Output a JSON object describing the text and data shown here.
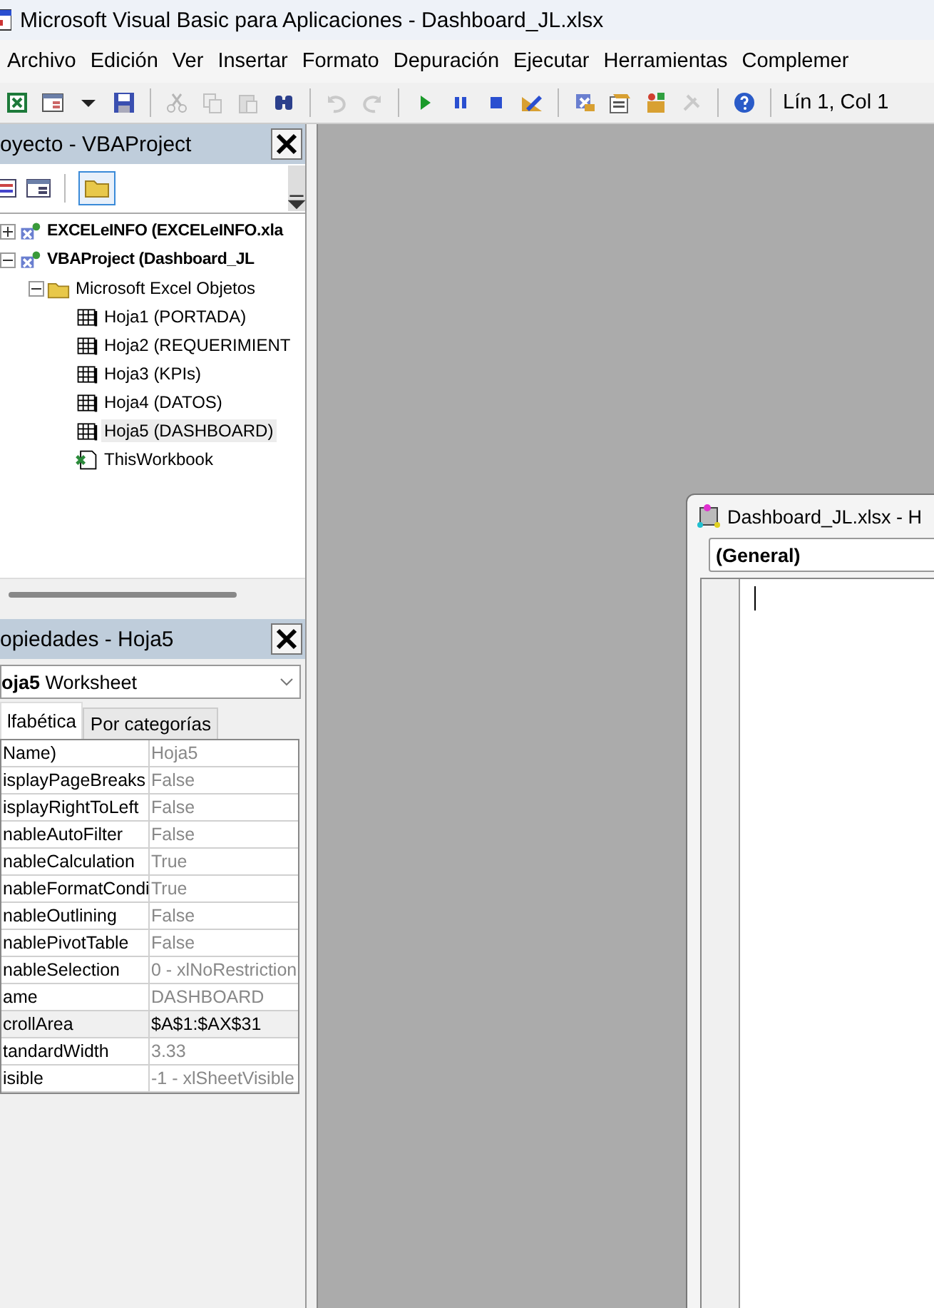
{
  "window": {
    "title": "Microsoft Visual Basic para Aplicaciones - Dashboard_JL.xlsx"
  },
  "menu": [
    "Archivo",
    "Edición",
    "Ver",
    "Insertar",
    "Formato",
    "Depuración",
    "Ejecutar",
    "Herramientas",
    "Complemer"
  ],
  "toolbar": {
    "items": [
      {
        "kind": "excel",
        "disabled": false
      },
      {
        "kind": "form",
        "disabled": false
      },
      {
        "kind": "dropdown",
        "disabled": false
      },
      {
        "kind": "save",
        "disabled": false
      },
      {
        "kind": "sep"
      },
      {
        "kind": "cut",
        "disabled": true
      },
      {
        "kind": "copy",
        "disabled": true
      },
      {
        "kind": "paste",
        "disabled": true
      },
      {
        "kind": "find",
        "disabled": false
      },
      {
        "kind": "sep"
      },
      {
        "kind": "undo",
        "disabled": true
      },
      {
        "kind": "redo",
        "disabled": true
      },
      {
        "kind": "sep"
      },
      {
        "kind": "run",
        "disabled": false
      },
      {
        "kind": "pause",
        "disabled": false
      },
      {
        "kind": "stop",
        "disabled": false
      },
      {
        "kind": "design",
        "disabled": false
      },
      {
        "kind": "sep"
      },
      {
        "kind": "explorer",
        "disabled": false
      },
      {
        "kind": "properties",
        "disabled": false
      },
      {
        "kind": "objects",
        "disabled": false
      },
      {
        "kind": "tools",
        "disabled": true
      },
      {
        "kind": "sep"
      },
      {
        "kind": "help",
        "disabled": false
      },
      {
        "kind": "sep"
      }
    ],
    "position": "Lín 1, Col 1"
  },
  "project_pane": {
    "title": "oyecto - VBAProject",
    "tree": [
      {
        "label": "EXCELeINFO (EXCELeINFO.xla",
        "kind": "project",
        "expanded": false,
        "selected": false
      },
      {
        "label": "VBAProject (Dashboard_JL",
        "kind": "project",
        "expanded": true,
        "selected": false,
        "children": [
          {
            "label": "Microsoft Excel Objetos",
            "kind": "folder",
            "expanded": true,
            "selected": false,
            "children": [
              {
                "label": "Hoja1 (PORTADA)",
                "kind": "sheet",
                "selected": false
              },
              {
                "label": "Hoja2 (REQUERIMIENT",
                "kind": "sheet",
                "selected": false
              },
              {
                "label": "Hoja3 (KPIs)",
                "kind": "sheet",
                "selected": false
              },
              {
                "label": "Hoja4 (DATOS)",
                "kind": "sheet",
                "selected": false
              },
              {
                "label": "Hoja5 (DASHBOARD)",
                "kind": "sheet",
                "selected": true
              },
              {
                "label": "ThisWorkbook",
                "kind": "workbook",
                "selected": false
              }
            ]
          }
        ]
      }
    ]
  },
  "properties_pane": {
    "title": "opiedades - Hoja5",
    "object": {
      "name": "oja5",
      "type": "Worksheet"
    },
    "tabs": [
      {
        "label": "lfabética",
        "selected": true
      },
      {
        "label": "Por categorías",
        "selected": false
      }
    ],
    "rows": [
      {
        "name": "Name)",
        "value": "Hoja5",
        "selected": false
      },
      {
        "name": "isplayPageBreaks",
        "value": "False",
        "selected": false
      },
      {
        "name": "isplayRightToLeft",
        "value": "False",
        "selected": false
      },
      {
        "name": "nableAutoFilter",
        "value": "False",
        "selected": false
      },
      {
        "name": "nableCalculation",
        "value": "True",
        "selected": false
      },
      {
        "name": "nableFormatCondi",
        "value": "True",
        "selected": false
      },
      {
        "name": "nableOutlining",
        "value": "False",
        "selected": false
      },
      {
        "name": "nablePivotTable",
        "value": "False",
        "selected": false
      },
      {
        "name": "nableSelection",
        "value": "0 - xlNoRestriction",
        "selected": false
      },
      {
        "name": "ame",
        "value": "DASHBOARD",
        "selected": false
      },
      {
        "name": "crollArea",
        "value": "$A$1:$AX$31",
        "selected": true
      },
      {
        "name": "tandardWidth",
        "value": "3.33",
        "selected": false
      },
      {
        "name": "isible",
        "value": "-1 - xlSheetVisible",
        "selected": false
      }
    ]
  },
  "code_window": {
    "title": "Dashboard_JL.xlsx - H",
    "object_combo": "(General)"
  }
}
